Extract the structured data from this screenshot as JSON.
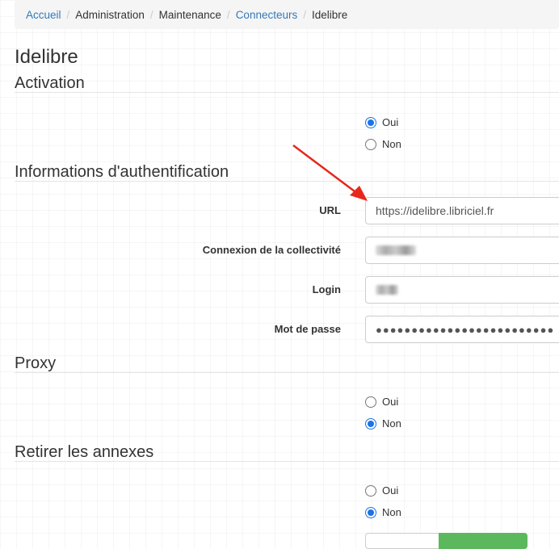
{
  "breadcrumb": {
    "items": [
      "Accueil",
      "Administration",
      "Maintenance",
      "Connecteurs",
      "Idelibre"
    ],
    "separator": "/"
  },
  "page": {
    "title": "Idelibre"
  },
  "sections": {
    "activation": {
      "title": "Activation",
      "options": [
        "Oui",
        "Non"
      ],
      "selected": "Oui"
    },
    "auth": {
      "title": "Informations d'authentification",
      "url_label": "URL",
      "url_value": "https://idelibre.libriciel.fr",
      "collectivite_label": "Connexion de la collectivité",
      "login_label": "Login",
      "password_label": "Mot de passe",
      "password_value": "●●●●●●●●●●●●●●●●●●●●●●●●●"
    },
    "proxy": {
      "title": "Proxy",
      "options": [
        "Oui",
        "Non"
      ],
      "selected": "Non"
    },
    "annexes": {
      "title": "Retirer les annexes",
      "options": [
        "Oui",
        "Non"
      ],
      "selected": "Non"
    }
  },
  "colors": {
    "link": "#337ab7",
    "radio_checked": "#1a73e8",
    "arrow": "#e8271c",
    "success": "#5cb85c"
  },
  "icons": {
    "annotation": "red-arrow-icon"
  }
}
